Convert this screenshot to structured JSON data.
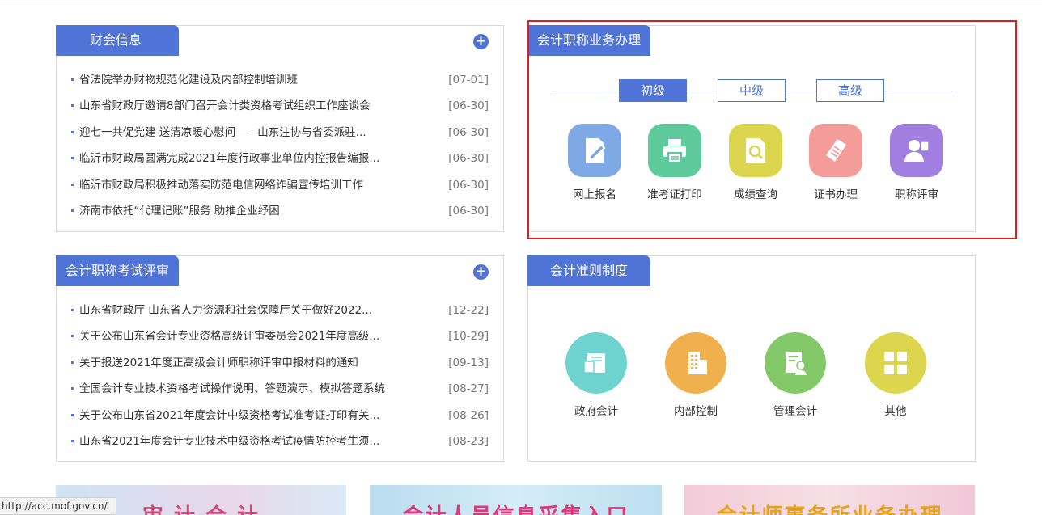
{
  "panels": {
    "finance": {
      "title": "财会信息",
      "items": [
        {
          "title": "省法院举办财物规范化建设及内部控制培训班",
          "date": "[07-01]"
        },
        {
          "title": "山东省财政厅邀请8部门召开会计类资格考试组织工作座谈会",
          "date": "[06-30]"
        },
        {
          "title": "迎七一共促党建 送清凉暖心慰问——山东注协与省委派驻...",
          "date": "[06-30]"
        },
        {
          "title": "临沂市财政局圆满完成2021年度行政事业单位内控报告编报...",
          "date": "[06-30]"
        },
        {
          "title": "临沂市财政局积极推动落实防范电信网络诈骗宣传培训工作",
          "date": "[06-30]"
        },
        {
          "title": "济南市依托“代理记账”服务 助推企业纾困",
          "date": "[06-30]"
        }
      ]
    },
    "business": {
      "title": "会计职称业务办理",
      "levels": [
        "初级",
        "中级",
        "高级"
      ],
      "services": [
        {
          "label": "网上报名",
          "icon": "edit-document-icon",
          "color": "#7fa9e4"
        },
        {
          "label": "准考证打印",
          "icon": "printer-icon",
          "color": "#5ec99a"
        },
        {
          "label": "成绩查询",
          "icon": "search-document-icon",
          "color": "#dcd64e"
        },
        {
          "label": "证书办理",
          "icon": "certificate-icon",
          "color": "#f39c9a"
        },
        {
          "label": "职称评审",
          "icon": "reviewer-icon",
          "color": "#a07fe0"
        }
      ]
    },
    "exam": {
      "title": "会计职称考试评审",
      "items": [
        {
          "title": "山东省财政厅 山东省人力资源和社会保障厅关于做好2022...",
          "date": "[12-22]"
        },
        {
          "title": "关于公布山东省会计专业资格高级评审委员会2021年度高级...",
          "date": "[10-29]"
        },
        {
          "title": "关于报送2021年度正高级会计师职称评审申报材料的通知",
          "date": "[09-13]"
        },
        {
          "title": "全国会计专业技术资格考试操作说明、答题演示、模拟答题系统",
          "date": "[08-27]"
        },
        {
          "title": "关于公布山东省2021年度会计中级资格考试准考证打印有关...",
          "date": "[08-26]"
        },
        {
          "title": "山东省2021年度会计专业技术中级资格考试疫情防控考生须...",
          "date": "[08-23]"
        }
      ]
    },
    "standards": {
      "title": "会计准则制度",
      "categories": [
        {
          "label": "政府会计",
          "icon": "book-icon",
          "color": "#6fd3cf"
        },
        {
          "label": "内部控制",
          "icon": "building-icon",
          "color": "#f0b04e"
        },
        {
          "label": "管理会计",
          "icon": "manager-icon",
          "color": "#83c96a"
        },
        {
          "label": "其他",
          "icon": "grid-icon",
          "color": "#dcd64e"
        }
      ]
    }
  },
  "banners": [
    "审 计 合 计",
    "会计人员信息采集入口",
    "会计师事务所业务办理"
  ],
  "status_url": "http://acc.mof.gov.cn/",
  "colors": {
    "accent": "#4f73d6",
    "highlight_border": "#e11c1c"
  }
}
